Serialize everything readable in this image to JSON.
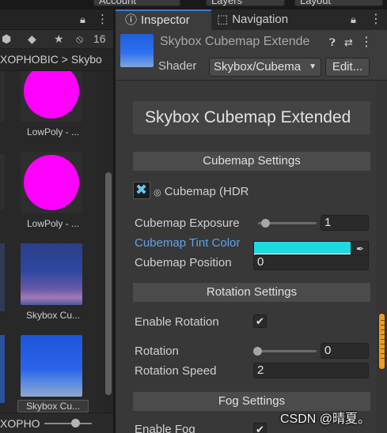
{
  "topbar": {
    "items": [
      "Account",
      "Layers",
      "Layout"
    ]
  },
  "project": {
    "filter_count": "16",
    "breadcrumb": "XOPHOBIC > Skybo",
    "assets": [
      {
        "label": "LowPoly - ...",
        "kind": "magenta-sphere"
      },
      {
        "label": "LowPoly - ...",
        "kind": "magenta-sphere"
      },
      {
        "label": "Skybox Cu...",
        "kind": "skybox-purple"
      },
      {
        "label": "Skybox Cu...",
        "kind": "skybox-blue",
        "selected": true
      }
    ],
    "footer_text": "XOPHO",
    "zoom_slider_level": 0.6
  },
  "inspector": {
    "tabs": [
      {
        "label": "Inspector",
        "icon": "info-icon",
        "active": true
      },
      {
        "label": "Navigation",
        "icon": "navigation-icon",
        "active": false
      }
    ],
    "header": {
      "title": "Skybox Cubemap Extende",
      "shader_label": "Shader",
      "shader_value": "Skybox/Cubema",
      "edit_label": "Edit..."
    },
    "material_name": "Skybox Cubemap Extended",
    "sections": {
      "cubemap": "Cubemap Settings",
      "rotation": "Rotation Settings",
      "fog": "Fog Settings"
    },
    "properties": {
      "cubemap_texture": "Cubemap (HDR",
      "exposure_label": "Cubemap Exposure",
      "exposure_value": "1",
      "exposure_slider": 0.125,
      "tint_label": "Cubemap Tint Color",
      "tint_color": "#1fd9e0",
      "position_label": "Cubemap Position",
      "position_value": "0",
      "enable_rotation_label": "Enable Rotation",
      "enable_rotation": true,
      "rotation_label": "Rotation",
      "rotation_value": "0",
      "rotation_slider": 0.0,
      "rotation_speed_label": "Rotation Speed",
      "rotation_speed_value": "2",
      "enable_fog_label": "Enable Fog",
      "enable_fog": true
    }
  },
  "watermark": "CSDN @晴夏。",
  "colors": {
    "accent_blue": "#5fa3ea",
    "scroll_orange": "#f39b1a",
    "tab_active": "#3a7bd5"
  }
}
